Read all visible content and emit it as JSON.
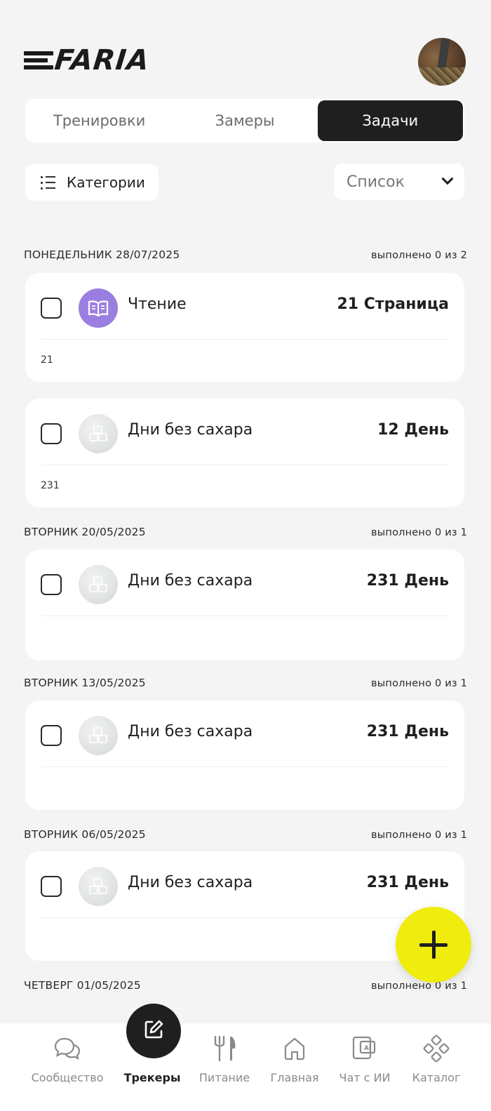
{
  "header": {
    "logo_text": "FARIA"
  },
  "tabs": [
    {
      "label": "Тренировки",
      "active": false
    },
    {
      "label": "Замеры",
      "active": false
    },
    {
      "label": "Задачи",
      "active": true
    }
  ],
  "filters": {
    "categories_label": "Категории",
    "view_label": "Список"
  },
  "days": [
    {
      "heading": "ПОНЕДЕЛЬНИК 28/07/2025",
      "done_text": "выполнено 0 из 2",
      "tasks": [
        {
          "title": "Чтение",
          "value": "21 Страница",
          "note": "21",
          "icon": "book-icon",
          "icon_color": "#9b7fe0"
        },
        {
          "title": "Дни без сахара",
          "value": "12 День",
          "note": "231",
          "icon": "sugar-cubes-icon"
        }
      ]
    },
    {
      "heading": "ВТОРНИК 20/05/2025",
      "done_text": "выполнено 0 из 1",
      "tasks": [
        {
          "title": "Дни без сахара",
          "value": "231 День",
          "note": "",
          "icon": "sugar-cubes-icon"
        }
      ]
    },
    {
      "heading": "ВТОРНИК 13/05/2025",
      "done_text": "выполнено 0 из 1",
      "tasks": [
        {
          "title": "Дни без сахара",
          "value": "231 День",
          "note": "",
          "icon": "sugar-cubes-icon"
        }
      ]
    },
    {
      "heading": "ВТОРНИК 06/05/2025",
      "done_text": "выполнено 0 из 1",
      "tasks": [
        {
          "title": "Дни без сахара",
          "value": "231 День",
          "note": "",
          "icon": "sugar-cubes-icon"
        }
      ]
    },
    {
      "heading": "ЧЕТВЕРГ 01/05/2025",
      "done_text": "выполнено 0 из 1",
      "tasks": []
    }
  ],
  "fab": {
    "icon": "plus-icon",
    "color": "#f0ec0e"
  },
  "bottom_nav": [
    {
      "label": "Сообщество",
      "icon": "chat-bubbles-icon",
      "active": false
    },
    {
      "label": "Трекеры",
      "icon": "edit-icon",
      "active": true
    },
    {
      "label": "Питание",
      "icon": "fork-knife-icon",
      "active": false
    },
    {
      "label": "Главная",
      "icon": "home-icon",
      "active": false
    },
    {
      "label": "Чат с ИИ",
      "icon": "ai-chat-icon",
      "active": false
    },
    {
      "label": "Каталог",
      "icon": "catalog-icon",
      "active": false
    }
  ]
}
